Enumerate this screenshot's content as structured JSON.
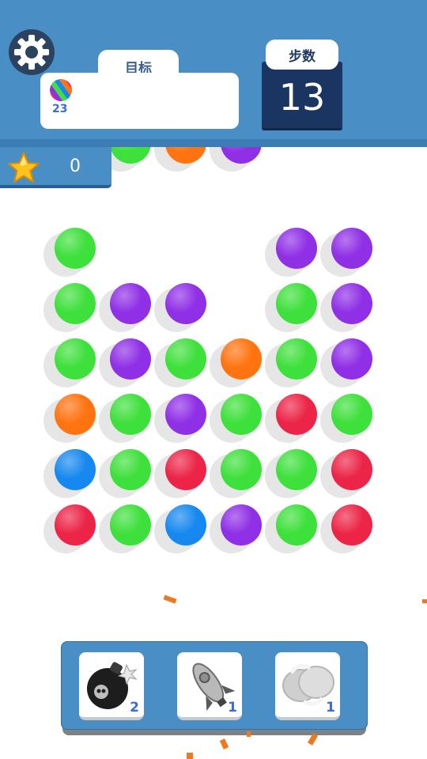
{
  "header": {
    "goal_label": "目标",
    "goal_count": "23",
    "steps_label": "步数",
    "steps_value": "13"
  },
  "score": {
    "value": "0"
  },
  "colors": {
    "green": "#3ee03b",
    "purple": "#8f2fe6",
    "orange": "#ff7410",
    "red": "#ec2447",
    "blue": "#1688f0"
  },
  "board": {
    "rows": [
      [
        "green",
        null,
        null,
        null,
        "purple",
        "purple"
      ],
      [
        "green",
        "purple",
        "purple",
        null,
        "green",
        "purple"
      ],
      [
        "green",
        "purple",
        "green",
        "orange",
        "green",
        "purple"
      ],
      [
        "orange",
        "green",
        "purple",
        "green",
        "red",
        "green"
      ],
      [
        "blue",
        "green",
        "red",
        "green",
        "green",
        "red"
      ],
      [
        "red",
        "green",
        "blue",
        "purple",
        "green",
        "red"
      ]
    ],
    "falling_row": [
      "green",
      "orange",
      "purple"
    ]
  },
  "boosters": [
    {
      "name": "bomb",
      "count": "2"
    },
    {
      "name": "rocket",
      "count": "1"
    },
    {
      "name": "swap",
      "count": "1"
    }
  ]
}
